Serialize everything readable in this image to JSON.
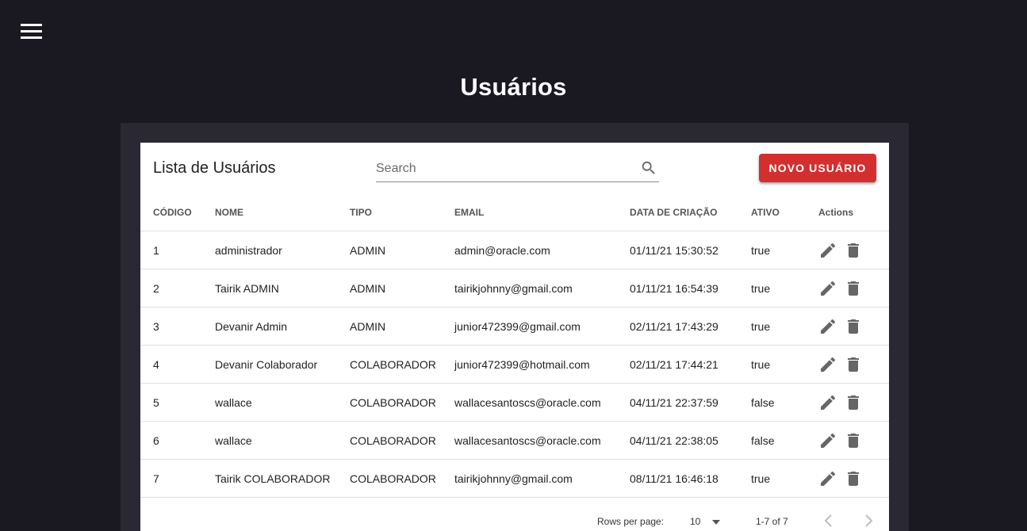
{
  "header": {
    "menu_icon": "hamburger-menu-icon",
    "title": "Usuários"
  },
  "card": {
    "title": "Lista de Usuários",
    "search": {
      "placeholder": "Search",
      "value": "",
      "icon": "search-icon"
    },
    "new_button_label": "NOVO USUÁRIO",
    "accent_color": "#d32f2f"
  },
  "table": {
    "columns": [
      "CÓDIGO",
      "NOME",
      "TIPO",
      "EMAIL",
      "DATA DE CRIAÇÃO",
      "ATIVO",
      "Actions"
    ],
    "rows": [
      {
        "codigo": "1",
        "nome": "administrador",
        "tipo": "ADMIN",
        "email": "admin@oracle.com",
        "data": "01/11/21 15:30:52",
        "ativo": "true"
      },
      {
        "codigo": "2",
        "nome": "Tairik ADMIN",
        "tipo": "ADMIN",
        "email": "tairikjohnny@gmail.com",
        "data": "01/11/21 16:54:39",
        "ativo": "true"
      },
      {
        "codigo": "3",
        "nome": "Devanir Admin",
        "tipo": "ADMIN",
        "email": "junior472399@gmail.com",
        "data": "02/11/21 17:43:29",
        "ativo": "true"
      },
      {
        "codigo": "4",
        "nome": "Devanir Colaborador",
        "tipo": "COLABORADOR",
        "email": "junior472399@hotmail.com",
        "data": "02/11/21 17:44:21",
        "ativo": "true"
      },
      {
        "codigo": "5",
        "nome": "wallace",
        "tipo": "COLABORADOR",
        "email": "wallacesantoscs@oracle.com",
        "data": "04/11/21 22:37:59",
        "ativo": "false"
      },
      {
        "codigo": "6",
        "nome": "wallace",
        "tipo": "COLABORADOR",
        "email": "wallacesantoscs@oracle.com",
        "data": "04/11/21 22:38:05",
        "ativo": "false"
      },
      {
        "codigo": "7",
        "nome": "Tairik COLABORADOR",
        "tipo": "COLABORADOR",
        "email": "tairikjohnny@gmail.com",
        "data": "08/11/21 16:46:18",
        "ativo": "true"
      }
    ],
    "row_action_icons": [
      "edit-pencil-icon",
      "delete-trash-icon"
    ]
  },
  "pagination": {
    "rows_per_page_label": "Rows per page:",
    "rows_per_page_value": "10",
    "range": "1-7 of 7",
    "prev_icon": "chevron-left-icon",
    "next_icon": "chevron-right-icon"
  }
}
